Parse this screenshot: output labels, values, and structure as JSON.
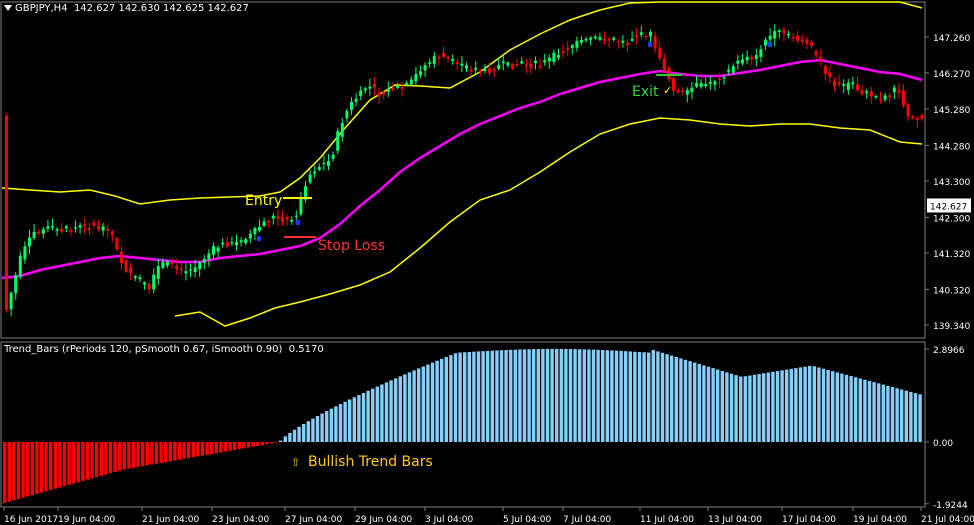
{
  "header": {
    "symbol": "GBPJPY,H4",
    "ohlc": "142.627 142.630 142.625 142.627"
  },
  "indicator": {
    "title": "Trend_Bars",
    "params": "(rPeriods 120, pSmooth 0.67, iSmooth 0.90)",
    "value": "0.5170",
    "axis_top": "2.8966",
    "axis_zero": "0.00",
    "axis_bottom": "-1.9244"
  },
  "price_axis": {
    "labels": [
      "147.260",
      "146.270",
      "145.280",
      "144.280",
      "143.300",
      "142.300",
      "141.320",
      "140.320",
      "139.340"
    ],
    "current": "142.627"
  },
  "time_axis": {
    "labels": [
      "16 Jun 2017",
      "19 Jun 04:00",
      "21 Jun 04:00",
      "23 Jun 04:00",
      "27 Jun 04:00",
      "29 Jun 04:00",
      "3 Jul 04:00",
      "5 Jul 04:00",
      "7 Jul 04:00",
      "11 Jul 04:00",
      "13 Jul 04:00",
      "17 Jul 04:00",
      "19 Jul 04:00",
      "21 Jul 04:00"
    ]
  },
  "annotations": {
    "entry": "Entry",
    "stop_loss": "Stop Loss",
    "exit": "Exit",
    "bullish": "Bullish Trend Bars",
    "bullish_arrow": "⇧"
  },
  "colors": {
    "background": "#000000",
    "bull_candle": "#00ff66",
    "bear_candle": "#ff0000",
    "bands": "#ffff00",
    "ma": "#ff00ff",
    "hist_pos": "#87cefa",
    "hist_neg": "#ff0000",
    "grid": "#7f7f7f"
  },
  "chart_data": {
    "type": "candlestick",
    "y_range": [
      139.0,
      148.2
    ],
    "indicator_range": [
      -1.9244,
      2.8966
    ]
  }
}
